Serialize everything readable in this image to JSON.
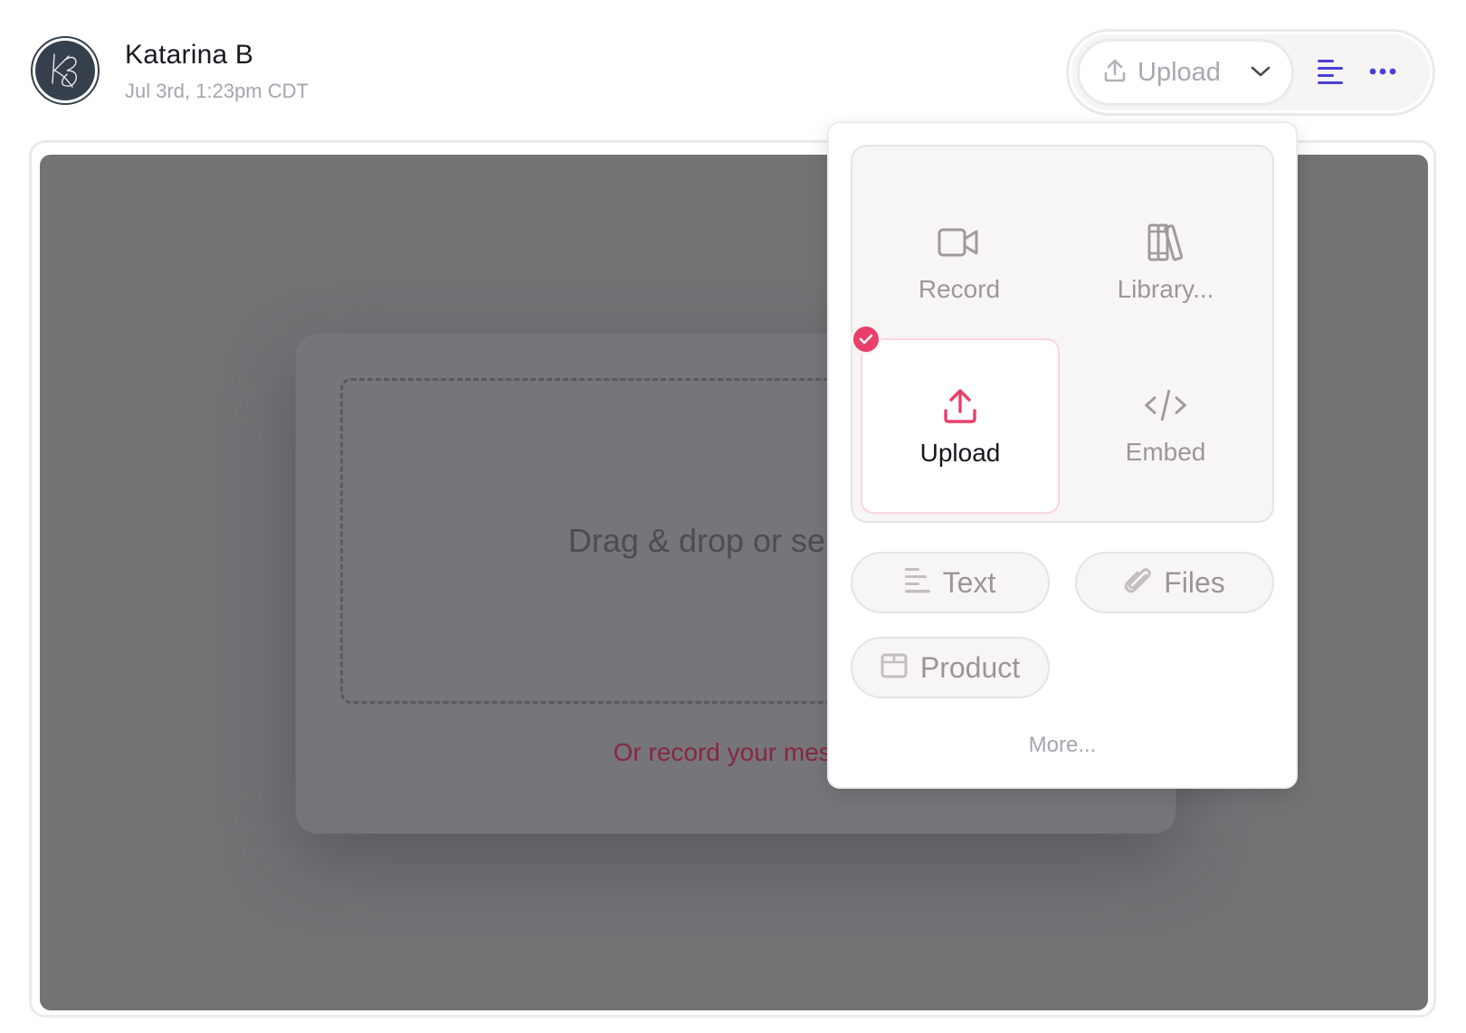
{
  "header": {
    "user_name": "Katarina B",
    "timestamp": "Jul 3rd, 1:23pm CDT",
    "avatar_initials": "KB"
  },
  "toolbar": {
    "upload_select_label": "Upload",
    "upload_icon": "upload-icon",
    "chevron_icon": "chevron-down-icon",
    "text_toggle_icon": "align-left-icon",
    "more_icon": "ellipsis-icon",
    "accent_color": "#4b3fd8"
  },
  "main": {
    "drop_text": "Drag & drop or select a",
    "record_link": "Or record your messa"
  },
  "dropdown": {
    "tiles": [
      {
        "label": "Record",
        "icon": "video-camera-icon",
        "selected": false
      },
      {
        "label": "Library...",
        "icon": "books-icon",
        "selected": false
      },
      {
        "label": "Upload",
        "icon": "upload-icon",
        "selected": true
      },
      {
        "label": "Embed",
        "icon": "code-icon",
        "selected": false
      }
    ],
    "chips": [
      {
        "label": "Text",
        "icon": "text-lines-icon"
      },
      {
        "label": "Files",
        "icon": "paperclip-icon"
      },
      {
        "label": "Product",
        "icon": "box-icon"
      }
    ],
    "more_label": "More...",
    "selected_color": "#e8406a"
  }
}
